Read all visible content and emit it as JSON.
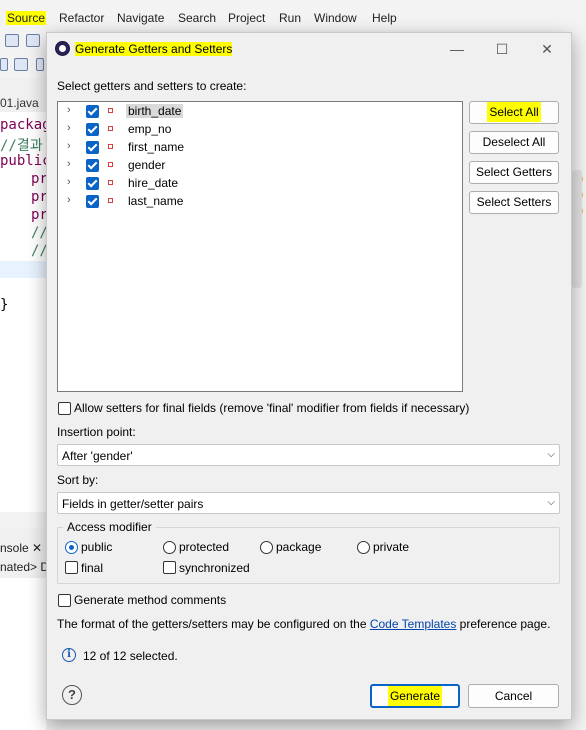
{
  "ide": {
    "menu": [
      "Source",
      "Refactor",
      "Navigate",
      "Search",
      "Project",
      "Run",
      "Window",
      "Help"
    ],
    "editor_tab": "01.java",
    "code_lines": [
      "packag",
      "//결과",
      "public",
      "pr",
      "pr",
      "pr",
      "//",
      "//",
      "}"
    ],
    "console_tab": "nsole",
    "console_close": "✕",
    "console_sub": "nated> D"
  },
  "dialog": {
    "title": "Generate Getters and Setters",
    "window_buttons": {
      "minimize": "—",
      "maximize": "☐",
      "close": "✕"
    },
    "select_label": "Select getters and setters to create:",
    "fields": [
      {
        "name": "birth_date",
        "checked": true,
        "selected": true
      },
      {
        "name": "emp_no",
        "checked": true
      },
      {
        "name": "first_name",
        "checked": true
      },
      {
        "name": "gender",
        "checked": true
      },
      {
        "name": "hire_date",
        "checked": true
      },
      {
        "name": "last_name",
        "checked": true
      }
    ],
    "buttons": {
      "select_all": "Select All",
      "deselect_all": "Deselect All",
      "select_getters": "Select Getters",
      "select_setters": "Select Setters",
      "generate": "Generate",
      "cancel": "Cancel"
    },
    "allow_final_label": "Allow setters for final fields (remove 'final' modifier from fields if necessary)",
    "insertion_label": "Insertion point:",
    "insertion_value": "After 'gender'",
    "sort_label": "Sort by:",
    "sort_value": "Fields in getter/setter pairs",
    "access_title": "Access modifier",
    "access": {
      "public": "public",
      "protected": "protected",
      "package": "package",
      "private": "private",
      "selected": "public"
    },
    "final_label": "final",
    "synchronized_label": "synchronized",
    "comments_label": "Generate method comments",
    "templates_prefix": "The format of the getters/setters may be configured on the ",
    "templates_link": "Code Templates",
    "templates_suffix": " preference page.",
    "status": "12 of 12 selected.",
    "help": "?",
    "info": "i",
    "chevron": "›",
    "dropdown_arrow": "⌵"
  },
  "colors": {
    "highlight": "#ffff00",
    "accent": "#0a64c8",
    "keyword": "#7f0055",
    "comment": "#3f7f5f"
  }
}
